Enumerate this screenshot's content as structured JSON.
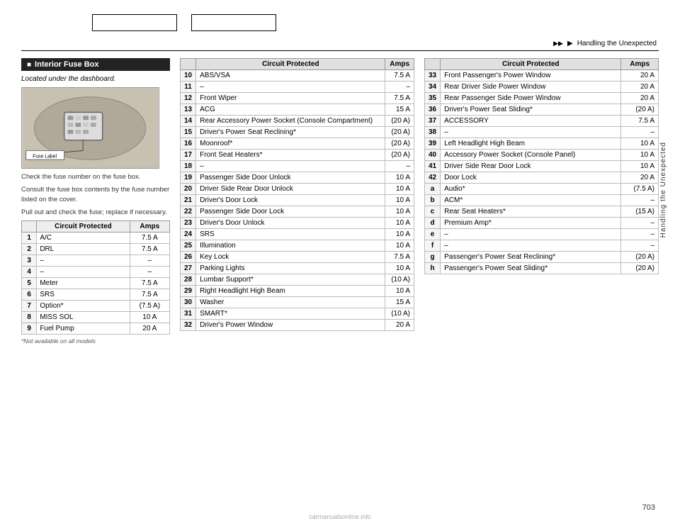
{
  "topNav": {
    "box1": "",
    "box2": ""
  },
  "chapterNav": {
    "arrow1": "▶▶",
    "sep1": "▶",
    "label": "Handling the Unexpected"
  },
  "sectionHeader": "Interior Fuse Box",
  "fuseBoxDesc": "Located under the dashboard.",
  "fuseLabel": "Fuse Label",
  "fuseInstructions1": "Check the fuse number on the fuse box.",
  "fuseInstructions2": "Consult the fuse box contents by the fuse number listed on the cover.",
  "fuseInstructions3": "Pull out and check the fuse; replace if necessary.",
  "leftTable": {
    "headers": [
      "Circuit Protected",
      "Amps"
    ],
    "rows": [
      {
        "num": "1",
        "circuit": "A/C",
        "amps": "7.5 A"
      },
      {
        "num": "2",
        "circuit": "DRL",
        "amps": "7.5 A"
      },
      {
        "num": "3",
        "circuit": "–",
        "amps": "–"
      },
      {
        "num": "4",
        "circuit": "–",
        "amps": "–"
      },
      {
        "num": "5",
        "circuit": "Meter",
        "amps": "7.5 A"
      },
      {
        "num": "6",
        "circuit": "SRS",
        "amps": "7.5 A"
      },
      {
        "num": "7",
        "circuit": "Option*",
        "amps": "(7.5 A)"
      },
      {
        "num": "8",
        "circuit": "MISS SOL",
        "amps": "10 A"
      },
      {
        "num": "9",
        "circuit": "Fuel Pump",
        "amps": "20 A"
      }
    ]
  },
  "footnote": "*Not available on all models",
  "midTable": {
    "headers": [
      "Circuit Protected",
      "Amps"
    ],
    "rows": [
      {
        "num": "10",
        "circuit": "ABS/VSA",
        "amps": "7.5 A"
      },
      {
        "num": "11",
        "circuit": "–",
        "amps": "–"
      },
      {
        "num": "12",
        "circuit": "Front Wiper",
        "amps": "7.5 A"
      },
      {
        "num": "13",
        "circuit": "ACG",
        "amps": "15 A"
      },
      {
        "num": "14",
        "circuit": "Rear Accessory Power Socket (Console Compartment)",
        "amps": "(20 A)"
      },
      {
        "num": "15",
        "circuit": "Driver's Power Seat Reclining*",
        "amps": "(20 A)"
      },
      {
        "num": "16",
        "circuit": "Moonroof*",
        "amps": "(20 A)"
      },
      {
        "num": "17",
        "circuit": "Front Seat Heaters*",
        "amps": "(20 A)"
      },
      {
        "num": "18",
        "circuit": "–",
        "amps": "–"
      },
      {
        "num": "19",
        "circuit": "Passenger Side Door Unlock",
        "amps": "10 A"
      },
      {
        "num": "20",
        "circuit": "Driver Side Rear Door Unlock",
        "amps": "10 A"
      },
      {
        "num": "21",
        "circuit": "Driver's Door Lock",
        "amps": "10 A"
      },
      {
        "num": "22",
        "circuit": "Passenger Side Door Lock",
        "amps": "10 A"
      },
      {
        "num": "23",
        "circuit": "Driver's Door Unlock",
        "amps": "10 A"
      },
      {
        "num": "24",
        "circuit": "SRS",
        "amps": "10 A"
      },
      {
        "num": "25",
        "circuit": "Illumination",
        "amps": "10 A"
      },
      {
        "num": "26",
        "circuit": "Key Lock",
        "amps": "7.5 A"
      },
      {
        "num": "27",
        "circuit": "Parking Lights",
        "amps": "10 A"
      },
      {
        "num": "28",
        "circuit": "Lumbar Support*",
        "amps": "(10 A)"
      },
      {
        "num": "29",
        "circuit": "Right Headlight High Beam",
        "amps": "10 A"
      },
      {
        "num": "30",
        "circuit": "Washer",
        "amps": "15 A"
      },
      {
        "num": "31",
        "circuit": "SMART*",
        "amps": "(10 A)"
      },
      {
        "num": "32",
        "circuit": "Driver's Power Window",
        "amps": "20 A"
      }
    ]
  },
  "rightTable": {
    "rows": [
      {
        "num": "33",
        "circuit": "Front Passenger's Power Window",
        "amps": "20 A"
      },
      {
        "num": "34",
        "circuit": "Rear Driver Side Power Window",
        "amps": "20 A"
      },
      {
        "num": "35",
        "circuit": "Rear Passenger Side Power Window",
        "amps": "20 A"
      },
      {
        "num": "36",
        "circuit": "Driver's Power Seat Sliding*",
        "amps": "(20 A)"
      },
      {
        "num": "37",
        "circuit": "ACCESSORY",
        "amps": "7.5 A"
      },
      {
        "num": "38",
        "circuit": "–",
        "amps": "–"
      },
      {
        "num": "39",
        "circuit": "Left Headlight High Beam",
        "amps": "10 A"
      },
      {
        "num": "40",
        "circuit": "Accessory Power Socket (Console Panel)",
        "amps": "10 A"
      },
      {
        "num": "41",
        "circuit": "Driver Side Rear Door Lock",
        "amps": "10 A"
      },
      {
        "num": "42",
        "circuit": "Door Lock",
        "amps": "20 A"
      },
      {
        "num": "a",
        "circuit": "Audio*",
        "amps": "(7.5 A)"
      },
      {
        "num": "b",
        "circuit": "ACM*",
        "amps": "–"
      },
      {
        "num": "c",
        "circuit": "Rear Seat Heaters*",
        "amps": "(15 A)"
      },
      {
        "num": "d",
        "circuit": "Premium Amp*",
        "amps": "–"
      },
      {
        "num": "e",
        "circuit": "–",
        "amps": "–"
      },
      {
        "num": "f",
        "circuit": "–",
        "amps": "–"
      },
      {
        "num": "g",
        "circuit": "Passenger's Power Seat Reclining*",
        "amps": "(20 A)"
      },
      {
        "num": "h",
        "circuit": "Passenger's Power Seat Sliding*",
        "amps": "(20 A)"
      }
    ]
  },
  "pageNumber": "703",
  "sideLabel": "Handling the Unexpected",
  "watermark": "carmanualsonline.info"
}
